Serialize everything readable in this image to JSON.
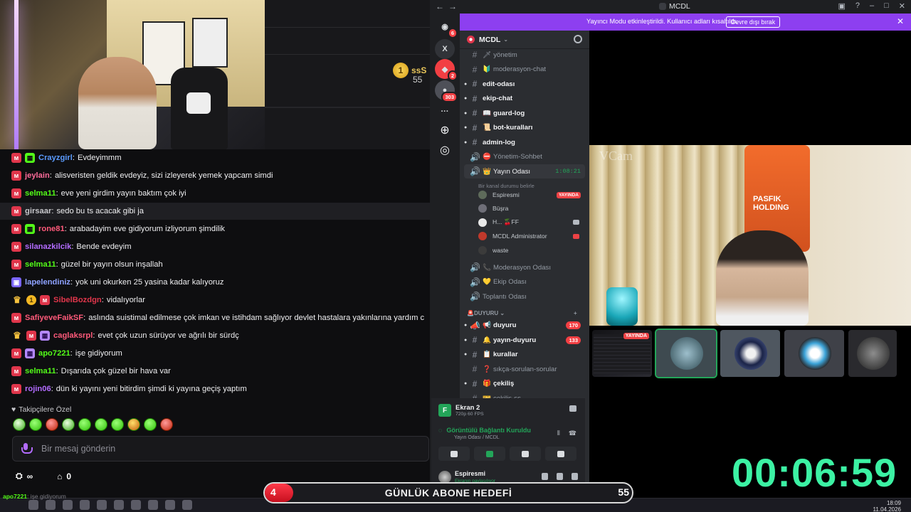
{
  "leaderboard": {
    "name": "ssS",
    "value": "55",
    "rank": "1"
  },
  "chat": {
    "messages": [
      {
        "badges": [
          "kick",
          "gift"
        ],
        "user": "Crayzgirl",
        "color": "#5b9bff",
        "text": "Evdeyimmm"
      },
      {
        "badges": [
          "kick"
        ],
        "user": "jeylain",
        "color": "#ff6b9a",
        "text": "alisveristen geldik evdeyiz, sizi izleyerek yemek yapcam simdi"
      },
      {
        "badges": [
          "kick"
        ],
        "user": "selma11",
        "color": "#53fc18",
        "text": "eve yeni girdim yayın baktım çok iyi"
      },
      {
        "badges": [
          "kick"
        ],
        "user": "girsaar",
        "color": "#c8c8cc",
        "text": "sedo bu ts acacak gibi ja"
      },
      {
        "badges": [
          "kick",
          "gift"
        ],
        "user": "rone81",
        "color": "#ff5a7a",
        "text": "arabadayim eve gidiyorum izliyorum şimdilik"
      },
      {
        "badges": [
          "kick"
        ],
        "user": "silanazkilcik",
        "color": "#b36cff",
        "text": "Bende evdeyim"
      },
      {
        "badges": [
          "kick"
        ],
        "user": "selma11",
        "color": "#53fc18",
        "text": "güzel bir yayın olsun inşallah"
      },
      {
        "badges": [
          "vip"
        ],
        "user": "lapelendiniz",
        "color": "#8ea2ff",
        "text": "yok uni okurken 25 yasina kadar kalıyoruz"
      },
      {
        "badges": [
          "crown",
          "one",
          "kick"
        ],
        "user": "SibelBozdgn",
        "color": "#e0364b",
        "text": "vidalıyorlar"
      },
      {
        "badges": [
          "kick"
        ],
        "user": "SafiyeveFaikSF",
        "color": "#ff5a7a",
        "text": "aslında suistimal edilmese çok imkan ve istihdam sağlıyor devlet hastalara yakınlarına yardım c"
      },
      {
        "badges": [
          "crown",
          "kick",
          "purple"
        ],
        "user": "caglaksrpl",
        "color": "#ff5a7a",
        "text": "evet çok uzun sürüyor ve ağrılı bir sürdç"
      },
      {
        "badges": [
          "kick",
          "purple"
        ],
        "user": "apo7221",
        "color": "#53fc18",
        "text": "işe gidiyorum"
      },
      {
        "badges": [
          "kick"
        ],
        "user": "selma11",
        "color": "#53fc18",
        "text": "Dışarıda çok güzel bir hava var"
      },
      {
        "badges": [
          "kick"
        ],
        "user": "rojin06",
        "color": "#b36cff",
        "text": "dün ki yayını yeni bitirdim şimdi ki yayına geçiş yaptım"
      }
    ],
    "follower_only": "Takipçilere Özel",
    "placeholder": "Bir mesaj gönderin",
    "stats": {
      "viewers": "∞",
      "count": "0"
    },
    "ticker": [
      {
        "user": "apo7221",
        "text": "işe gidiyorum"
      }
    ]
  },
  "discord": {
    "window_title": "MCDL",
    "banner_text": "Yayıncı Modu etkinleştirildi. Kullanıcı adları kısaltıldı.",
    "banner_button": "Devre dışı bırak",
    "server_name": "MCDL",
    "guild_badges": [
      "6",
      "2",
      "303"
    ],
    "channels": [
      {
        "name": "yönetim",
        "type": "text",
        "prefix": "🗡"
      },
      {
        "name": "moderasyon-chat",
        "type": "text",
        "prefix": "🔰"
      },
      {
        "name": "edit-odası",
        "type": "text",
        "unread": true
      },
      {
        "name": "ekip-chat",
        "type": "text",
        "unread": true
      },
      {
        "name": "guard-log",
        "type": "text",
        "unread": true,
        "prefix": "📖"
      },
      {
        "name": "bot-kuralları",
        "type": "text",
        "unread": true,
        "prefix": "📜"
      },
      {
        "name": "admin-log",
        "type": "text",
        "unread": true
      },
      {
        "name": "Yönetim-Sohbet",
        "type": "voice",
        "prefix": "⛔"
      }
    ],
    "live_channel": {
      "name": "Yayın Odası",
      "time": "1:08:21",
      "subtitle": "Bir kanal durumu belirle"
    },
    "voice_members": [
      {
        "name": "Espiresmi",
        "live": "YAYINDA"
      },
      {
        "name": "Büşra"
      },
      {
        "name": "H... 🍒FF"
      },
      {
        "name": "MCDL Administrator"
      },
      {
        "name": "waste"
      }
    ],
    "voice_channels": [
      {
        "name": "Moderasyon Odası",
        "prefix": "📞"
      },
      {
        "name": "Ekip Odası",
        "prefix": "💛"
      },
      {
        "name": "Toplantı Odası"
      }
    ],
    "category": "🚨DUYURU",
    "announce_channels": [
      {
        "name": "duyuru",
        "prefix": "📢",
        "count": "170",
        "unread": true
      },
      {
        "name": "yayın-duyuru",
        "prefix": "🔔",
        "count": "133",
        "unread": true
      },
      {
        "name": "kurallar",
        "prefix": "📋",
        "unread": true
      },
      {
        "name": "sıkça-sorulan-sorular",
        "prefix": "❓"
      },
      {
        "name": "çekiliş",
        "prefix": "🎁",
        "unread": true
      },
      {
        "name": "çekiliş-ss",
        "prefix": "🎫"
      }
    ],
    "screen_share": {
      "title": "Ekran 2",
      "quality": "720p 60 FPS"
    },
    "connection": {
      "status": "Görüntülü Bağlantı Kuruldu",
      "channel": "Yayın Odası / MCDL"
    },
    "user": {
      "name": "Espiresmi",
      "status": "Ekranın paylaşılıyor"
    },
    "video_overlay": "VCam",
    "jersey_text": "PASFIK HOLDING",
    "thumb_live": "YAYINDA"
  },
  "timer": "00:06:59",
  "goal": {
    "label": "GÜNLÜK ABONE HEDEFİ",
    "current": "4",
    "target": "55",
    "progress": 0.0727
  },
  "clock": {
    "time": "18:09",
    "date": "11.04.2026"
  }
}
